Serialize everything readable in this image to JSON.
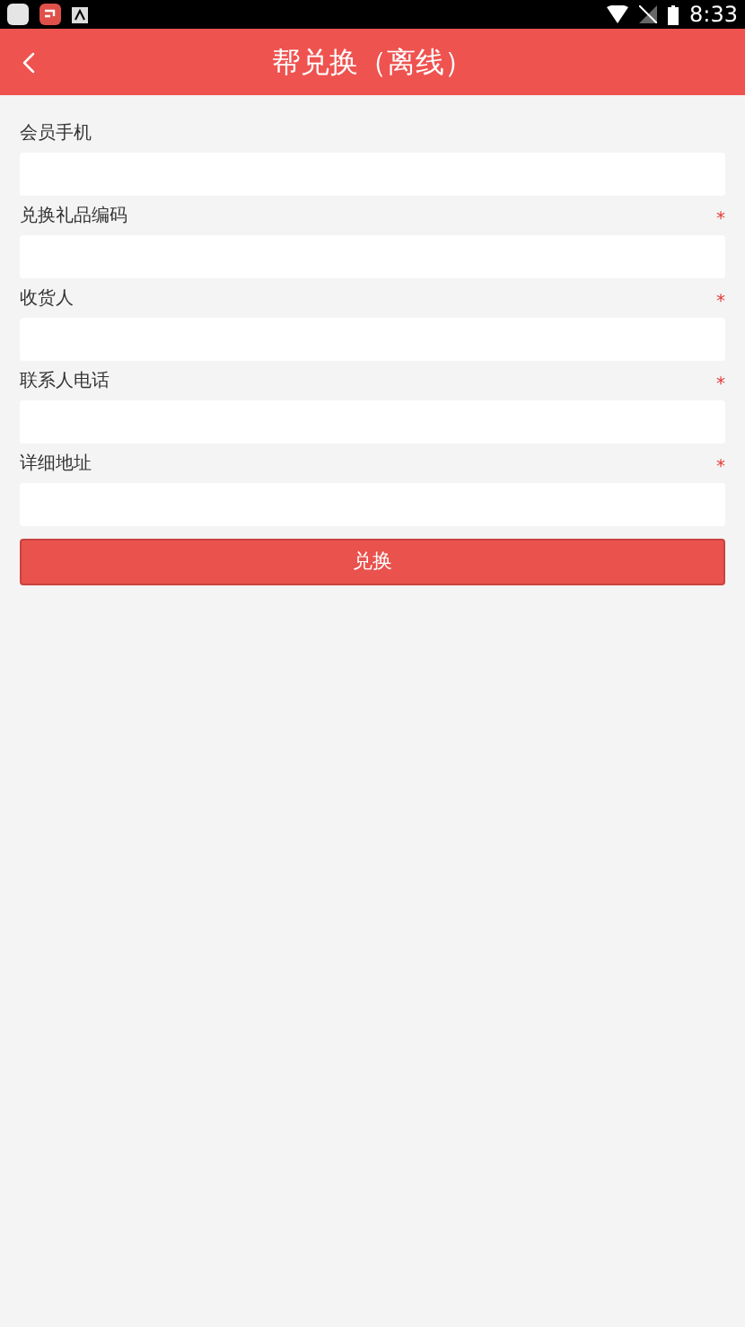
{
  "status_bar": {
    "time": "8:33"
  },
  "header": {
    "title": "帮兑换（离线）"
  },
  "fields": [
    {
      "label": "会员手机"
    },
    {
      "label": "兑换礼品编码",
      "required_mark": "*"
    },
    {
      "label": "收货人",
      "required_mark": "*"
    },
    {
      "label": "联系人电话",
      "required_mark": "*"
    },
    {
      "label": "详细地址",
      "required_mark": "*"
    }
  ],
  "submit_button": {
    "label": "兑换"
  }
}
